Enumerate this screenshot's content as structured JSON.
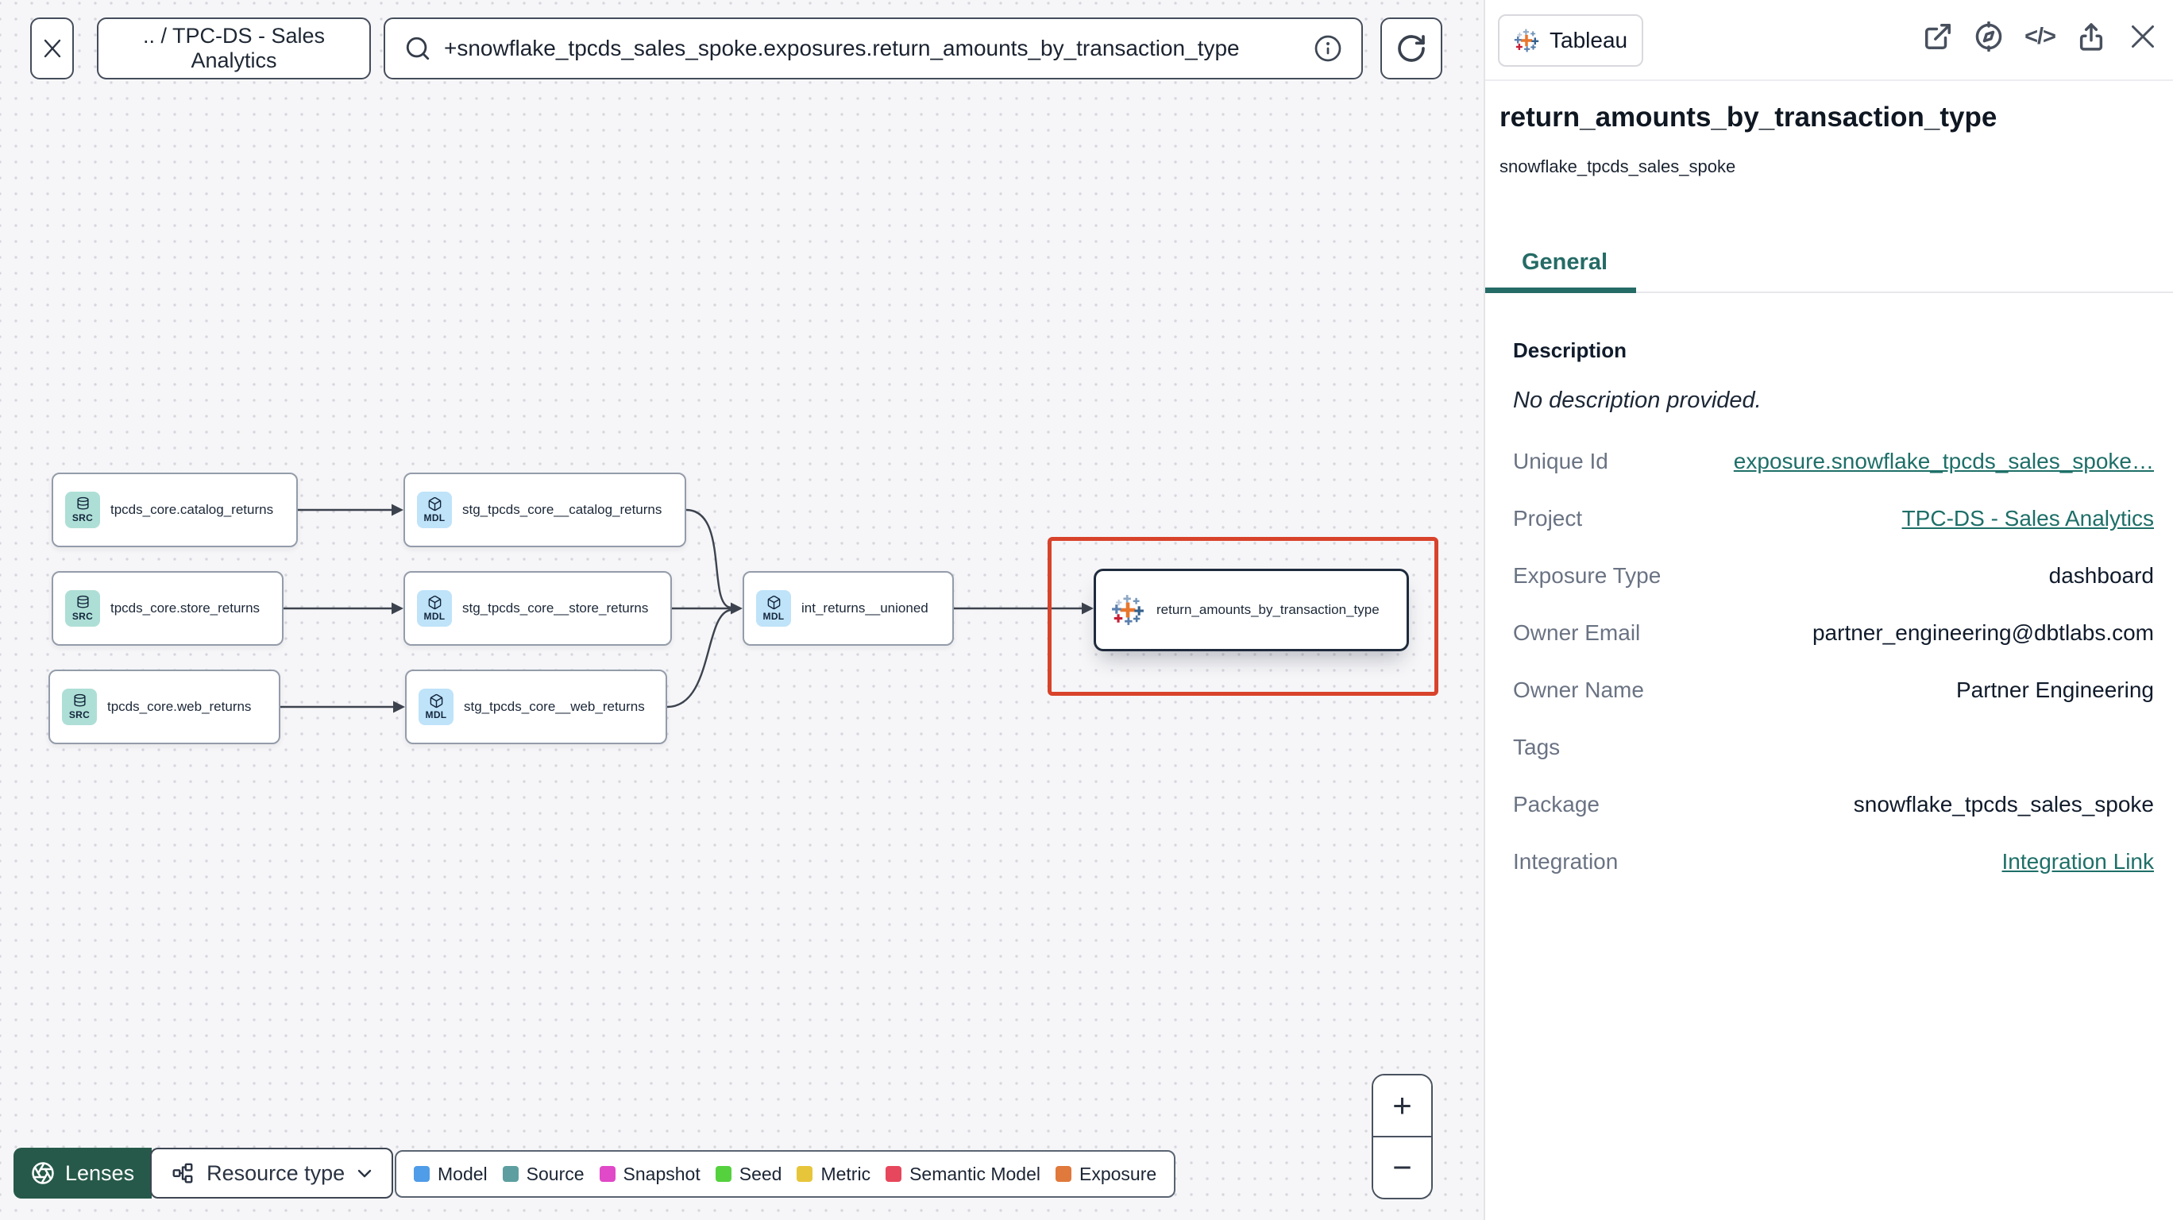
{
  "toolbar": {
    "breadcrumb": ".. / TPC-DS - Sales Analytics",
    "search_value": "+snowflake_tpcds_sales_spoke.exposures.return_amounts_by_transaction_type"
  },
  "icons": {
    "code_glyph": "</>"
  },
  "graph": {
    "nodes": [
      {
        "badge": "SRC",
        "label": "tpcds_core.catalog_returns"
      },
      {
        "badge": "SRC",
        "label": "tpcds_core.store_returns"
      },
      {
        "badge": "SRC",
        "label": "tpcds_core.web_returns"
      },
      {
        "badge": "MDL",
        "label": "stg_tpcds_core__catalog_returns"
      },
      {
        "badge": "MDL",
        "label": "stg_tpcds_core__store_returns"
      },
      {
        "badge": "MDL",
        "label": "stg_tpcds_core__web_returns"
      },
      {
        "badge": "MDL",
        "label": "int_returns__unioned"
      },
      {
        "badge": "tableau",
        "label": "return_amounts_by_transaction_type"
      }
    ]
  },
  "controls": {
    "lenses_label": "Lenses",
    "resource_type_label": "Resource type",
    "zoom_in": "+",
    "zoom_out": "−"
  },
  "legend": {
    "items": [
      {
        "label": "Model",
        "color": "#4f9ce8"
      },
      {
        "label": "Source",
        "color": "#5d9fa0"
      },
      {
        "label": "Snapshot",
        "color": "#e049c7"
      },
      {
        "label": "Seed",
        "color": "#55d13e"
      },
      {
        "label": "Metric",
        "color": "#e7c53b"
      },
      {
        "label": "Semantic Model",
        "color": "#e6475c"
      },
      {
        "label": "Exposure",
        "color": "#e0793c"
      }
    ]
  },
  "panel": {
    "integration_badge": "Tableau",
    "title": "return_amounts_by_transaction_type",
    "subtitle": "snowflake_tpcds_sales_spoke",
    "tab_general": "General",
    "description_label": "Description",
    "description_value": "No description provided.",
    "fields": [
      {
        "label": "Unique Id",
        "value": "exposure.snowflake_tpcds_sales_spoke…"
      },
      {
        "label": "Project",
        "value": "TPC-DS - Sales Analytics"
      },
      {
        "label": "Exposure Type",
        "value": "dashboard"
      },
      {
        "label": "Owner Email",
        "value": "partner_engineering@dbtlabs.com"
      },
      {
        "label": "Owner Name",
        "value": "Partner Engineering"
      },
      {
        "label": "Tags",
        "value": ""
      },
      {
        "label": "Package",
        "value": "snowflake_tpcds_sales_spoke"
      },
      {
        "label": "Integration",
        "value": "Integration Link"
      }
    ],
    "accent_teal": "#256b66",
    "highlight_red": "#d8432b"
  }
}
